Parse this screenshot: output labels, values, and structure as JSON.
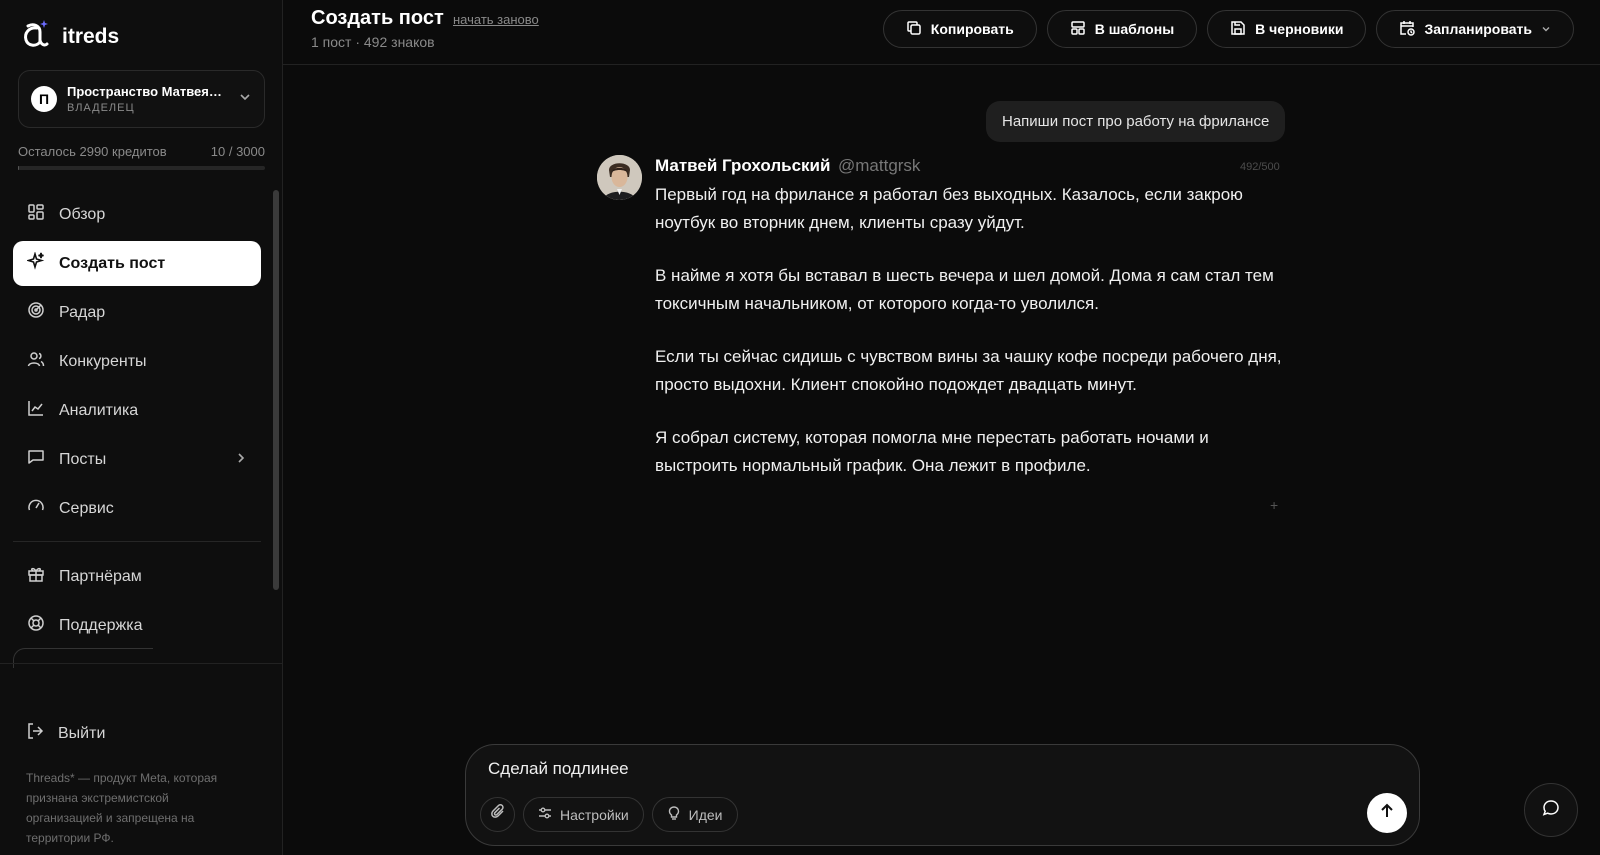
{
  "app": {
    "name": "itreds"
  },
  "workspace": {
    "name": "Пространство Матвея Грохольского",
    "initial": "П",
    "role": "ВЛАДЕЛЕЦ"
  },
  "credits": {
    "label": "Осталось 2990 кредитов",
    "usage": "10 / 3000",
    "used_fraction": 0.0033
  },
  "nav": {
    "items": [
      {
        "label": "Обзор",
        "icon": "grid-icon"
      },
      {
        "label": "Создать пост",
        "icon": "sparkle-icon",
        "active": true
      },
      {
        "label": "Радар",
        "icon": "radar-icon"
      },
      {
        "label": "Конкуренты",
        "icon": "users-icon"
      },
      {
        "label": "Аналитика",
        "icon": "chart-line-icon"
      },
      {
        "label": "Посты",
        "icon": "message-square-icon",
        "has_submenu": true
      },
      {
        "label": "Сервис",
        "icon": "gauge-icon"
      }
    ],
    "secondary": [
      {
        "label": "Партнёрам",
        "icon": "gift-icon"
      },
      {
        "label": "Поддержка",
        "icon": "lifebuoy-icon"
      }
    ],
    "logout": "Выйти"
  },
  "disclaimer": "Threads* — продукт Meta, которая признана экстремистской организацией и запрещена на территории РФ.",
  "header": {
    "title": "Создать пост",
    "restart": "начать заново",
    "meta": "1 пост · 492 знаков",
    "buttons": {
      "copy": "Копировать",
      "templates": "В шаблоны",
      "drafts": "В черновики",
      "schedule": "Запланировать"
    }
  },
  "chat": {
    "user_message": "Напиши пост про работу на фрилансе",
    "post": {
      "author": "Матвей Грохольский",
      "handle": "@mattgrsk",
      "char_count": "492/500",
      "paragraphs": [
        "Первый год на фрилансе я работал без выходных. Казалось, если закрою ноутбук во вторник днем, клиенты сразу уйдут.",
        "В найме я хотя бы вставал в шесть вечера и шел домой. Дома я сам стал тем токсичным начальником, от которого когда-то уволился.",
        "Если ты сейчас сидишь с чувством вины за чашку кофе посреди рабочего дня, просто выдохни. Клиент спокойно подождет двадцать минут.",
        "Я собрал систему, которая помогла мне перестать работать ночами и выстроить нормальный график. Она лежит в профиле."
      ],
      "add_symbol": "+"
    }
  },
  "composer": {
    "value": "Сделай подлинее",
    "settings": "Настройки",
    "ideas": "Идеи"
  },
  "colors": {
    "background": "#0b0b0b",
    "sidebar": "#0e0e0e",
    "active_item": "#ffffff",
    "muted_text": "#8a8a8a"
  }
}
